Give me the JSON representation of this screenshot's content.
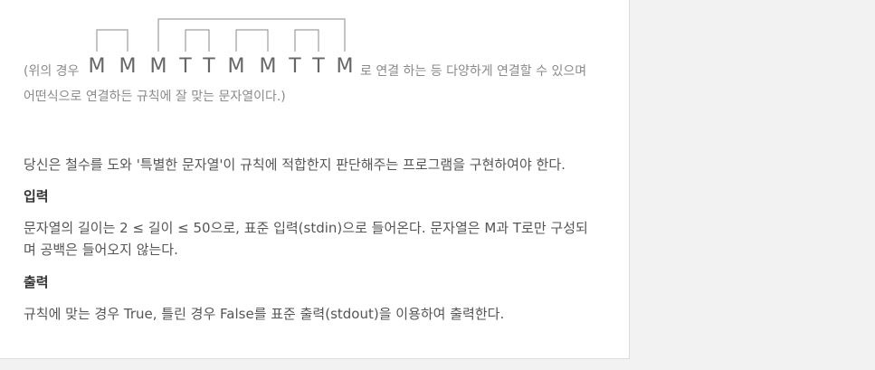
{
  "example": {
    "prefix": "(위의 경우",
    "letters": [
      "M",
      "M",
      "M",
      "T",
      "T",
      "M",
      "M",
      "T",
      "T",
      "M"
    ],
    "suffix": "로 연결 하는 등 다양하게 연결할 수 있으며",
    "line2": "어떤식으로 연결하든 규칙에 잘 맞는 문자열이다.)"
  },
  "description": "당신은 철수를 도와 '특별한 문자열'이 규칙에 적합한지 판단해주는 프로그램을 구현하여야 한다.",
  "input": {
    "heading": "입력",
    "line1": "문자열의 길이는 2 ≤ 길이 ≤ 50으로, 표준 입력(stdin)으로 들어온다. 문자열은 M과 T로만 구성되",
    "line2": "며 공백은 들어오지 않는다."
  },
  "output": {
    "heading": "출력",
    "line1": "규칙에 맞는 경우 True, 틀린 경우 False를 표준 출력(stdout)을 이용하여 출력한다."
  }
}
